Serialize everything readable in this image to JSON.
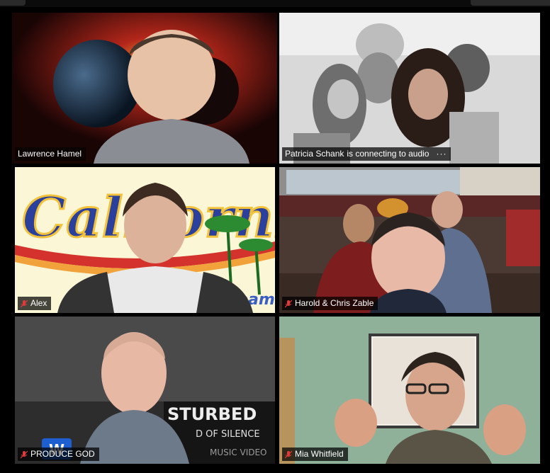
{
  "participants": [
    {
      "name": "Lawrence Hamel",
      "muted": false,
      "status": "",
      "active_speaker": true
    },
    {
      "name": "Patricia Schank",
      "muted": false,
      "status": "is connecting to audio",
      "more": "···",
      "active_speaker": false
    },
    {
      "name": "Alex",
      "muted": true,
      "status": "",
      "active_speaker": false
    },
    {
      "name": "Harold & Chris Zable",
      "muted": true,
      "status": "",
      "active_speaker": false
    },
    {
      "name": "PRODUCE GOD",
      "muted": true,
      "status": "",
      "active_speaker": false
    },
    {
      "name": "Mia Whitfield",
      "muted": true,
      "status": "",
      "active_speaker": false
    }
  ],
  "backgrounds": {
    "alex": {
      "line1": "California",
      "line2": "Dreaming"
    },
    "produce_god": {
      "line1": "STURBED",
      "line2": "D OF SILENCE",
      "line3": "MUSIC VIDEO",
      "logo": "W"
    }
  },
  "colors": {
    "active_speaker_border": "#c8e06a",
    "mute_icon": "#e03a3a",
    "nameplate_bg": "#000000"
  }
}
